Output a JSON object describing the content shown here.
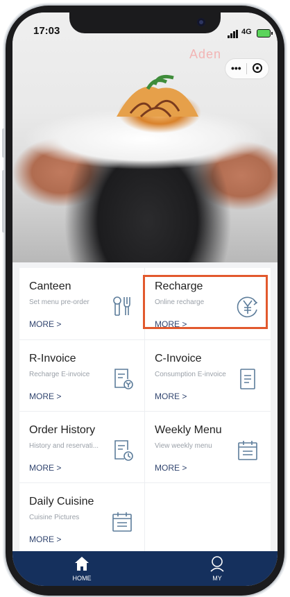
{
  "status_bar": {
    "time": "17:03",
    "network": "4G"
  },
  "hero": {
    "brand_text": "Aden",
    "menu_label": "•••"
  },
  "accent_color": "#e2592d",
  "tabbar_color": "#15305d",
  "tiles": [
    {
      "title": "Canteen",
      "subtitle": "Set menu pre-order",
      "more": "MORE >",
      "icon": "utensils-icon"
    },
    {
      "title": "Recharge",
      "subtitle": "Online recharge",
      "more": "MORE >",
      "icon": "yen-recharge-icon"
    },
    {
      "title": "R-Invoice",
      "subtitle": "Recharge E-invoice",
      "more": "MORE >",
      "icon": "invoice-yen-icon"
    },
    {
      "title": "C-Invoice",
      "subtitle": "Consumption E-invoice",
      "more": "MORE >",
      "icon": "document-icon"
    },
    {
      "title": "Order History",
      "subtitle": "History and reservati...",
      "more": "MORE >",
      "icon": "history-icon"
    },
    {
      "title": "Weekly Menu",
      "subtitle": "View weekly menu",
      "more": "MORE >",
      "icon": "calendar-icon"
    },
    {
      "title": "Daily Cuisine",
      "subtitle": "Cuisine Pictures",
      "more": "MORE >",
      "icon": "calendar-icon"
    }
  ],
  "tabbar": {
    "home": "HOME",
    "my": "MY"
  }
}
